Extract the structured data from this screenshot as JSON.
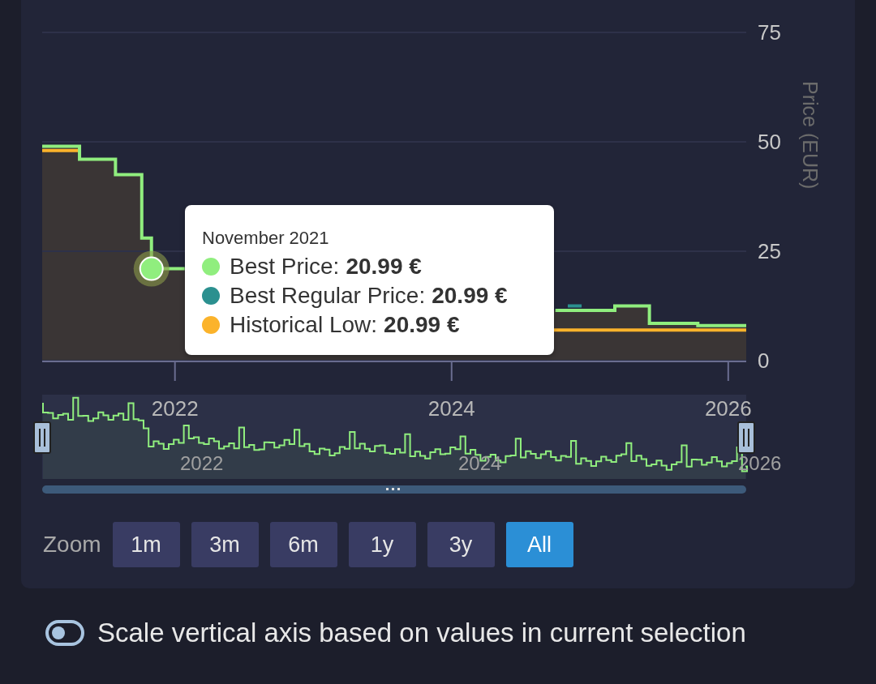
{
  "price_chart": {
    "chart_data": {
      "type": "line",
      "ylabel": "Price (EUR)",
      "xlim": [
        2021.04,
        2026.13
      ],
      "ylim": [
        0,
        75
      ],
      "x": [
        2021.04,
        2021.31,
        2021.31,
        2021.57,
        2021.57,
        2021.76,
        2021.76,
        2021.83,
        2021.83,
        2022.07,
        2024.74,
        2024.75,
        2024.84,
        2024.94,
        2025.18,
        2025.18,
        2025.43,
        2025.43,
        2025.78,
        2025.78,
        2026.13
      ],
      "series": [
        {
          "color": "#fbb32b",
          "values": [
            48,
            48,
            null,
            null,
            null,
            null,
            null,
            null,
            null,
            null,
            7,
            7,
            7,
            7,
            7,
            7,
            7,
            7,
            7,
            7,
            7
          ]
        },
        {
          "color": "#90ee7e",
          "values": [
            49,
            49,
            46,
            46,
            42.5,
            42.5,
            28,
            28,
            21,
            21,
            null,
            11.5,
            11.5,
            11.5,
            11.5,
            12.5,
            12.5,
            8.5,
            8.5,
            8,
            8
          ]
        },
        {
          "color": "#2b908f",
          "values": [
            null,
            null,
            null,
            null,
            null,
            null,
            null,
            null,
            null,
            null,
            null,
            null,
            12.5,
            12.5,
            null,
            null,
            null,
            null,
            null,
            null,
            null
          ]
        }
      ],
      "xticks": [
        2022,
        2024,
        2026
      ],
      "yticks": [
        0,
        25,
        50,
        75
      ]
    },
    "tooltip": {
      "title": "November 2021",
      "rows": [
        {
          "label": "Best Price:",
          "value": "20.99 €",
          "color": "#90ee7e"
        },
        {
          "label": "Best Regular Price:",
          "value": "20.99 €",
          "color": "#2b908f"
        },
        {
          "label": "Historical Low:",
          "value": "20.99 €",
          "color": "#fbb32b"
        }
      ]
    }
  },
  "navigator": {
    "labels": [
      "2022",
      "2024",
      "2026"
    ]
  },
  "zoom": {
    "label": "Zoom",
    "buttons": [
      {
        "label": "1m",
        "selected": false
      },
      {
        "label": "3m",
        "selected": false
      },
      {
        "label": "6m",
        "selected": false
      },
      {
        "label": "1y",
        "selected": false
      },
      {
        "label": "3y",
        "selected": false
      },
      {
        "label": "All",
        "selected": true
      }
    ]
  },
  "scale_toggle": {
    "label": "Scale vertical axis based on values in current selection",
    "on": false
  }
}
